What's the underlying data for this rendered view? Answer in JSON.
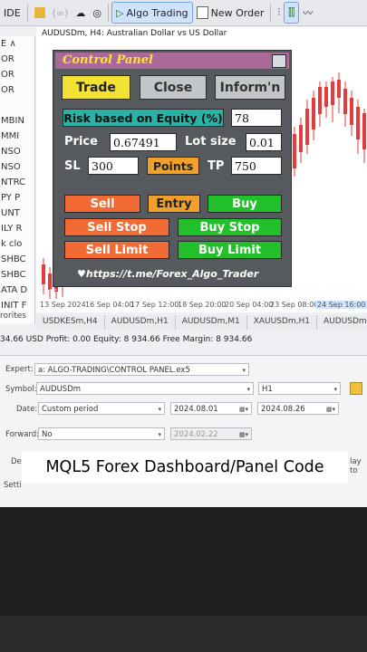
{
  "toolbar": {
    "ide_label": "IDE",
    "algo_trading_label": "Algo Trading",
    "new_order_label": "New Order"
  },
  "navigator": {
    "rows": [
      "E ∧",
      "OR",
      "OR",
      "OR",
      "",
      "MBIN",
      "MMI",
      "NSO",
      "NSO",
      "NTRC",
      "PY P",
      "UNT",
      "ILY R",
      "k clo",
      "SHBC",
      "SHBC",
      "ATA D",
      "INIT F"
    ],
    "bottom_label": "rorites"
  },
  "chart": {
    "title": "AUDUSDm, H4:  Australian Dollar vs US Dollar",
    "x_ticks": [
      "13 Sep 2024",
      "16 Sep 04:00",
      "17 Sep 12:00",
      "18 Sep 20:00",
      "20 Sep 04:00",
      "23 Sep 08:00",
      "24 Sep 16:00"
    ],
    "tabs": [
      "USDKESm,H4",
      "AUDUSDm,H1",
      "AUDUSDm,M1",
      "XAUUSDm,H1",
      "AUDUSDm"
    ]
  },
  "account_bar": "34.66 USD  Profit: 0.00  Equity: 8 934.66  Free Margin: 8 934.66",
  "panel": {
    "title": "Control Panel",
    "tabs": {
      "trade": "Trade",
      "close": "Close",
      "inform": "Inform'n"
    },
    "risk_label": "Risk based on Equity (%)",
    "risk_value": "78",
    "price_label": "Price",
    "price_value": "0.67491",
    "lot_label": "Lot size",
    "lot_value": "0.01",
    "sl_label": "SL",
    "sl_value": "300",
    "points_label": "Points",
    "tp_label": "TP",
    "tp_value": "750",
    "sell": "Sell",
    "entry": "Entry",
    "buy": "Buy",
    "sell_stop": "Sell Stop",
    "buy_stop": "Buy Stop",
    "sell_limit": "Sell Limit",
    "buy_limit": "Buy Limit",
    "link": "https://t.me/Forex_Algo_Trader",
    "colors": {
      "yellow": "#f2e233",
      "gray": "#c3c6c9",
      "teal": "#29b2a6",
      "orange": "#f26b35",
      "green": "#22c02a",
      "amber": "#efa12c"
    }
  },
  "tester": {
    "expert_label": "Expert:",
    "expert_value": "a: ALGO-TRADING\\CONTROL PANEL.ex5",
    "symbol_label": "Symbol:",
    "symbol_value": "AUDUSDm",
    "timeframe_value": "H1",
    "date_label": "Date:",
    "date_mode": "Custom period",
    "date_from": "2024.08.01",
    "date_to": "2024.08.26",
    "forward_label": "Forward:",
    "forward_value": "No",
    "forward_date": "2024.02.22",
    "delay_label": "lay to",
    "de_label": "De",
    "settings_label": "Setti"
  },
  "caption": "MQL5 Forex Dashboard/Panel Code"
}
